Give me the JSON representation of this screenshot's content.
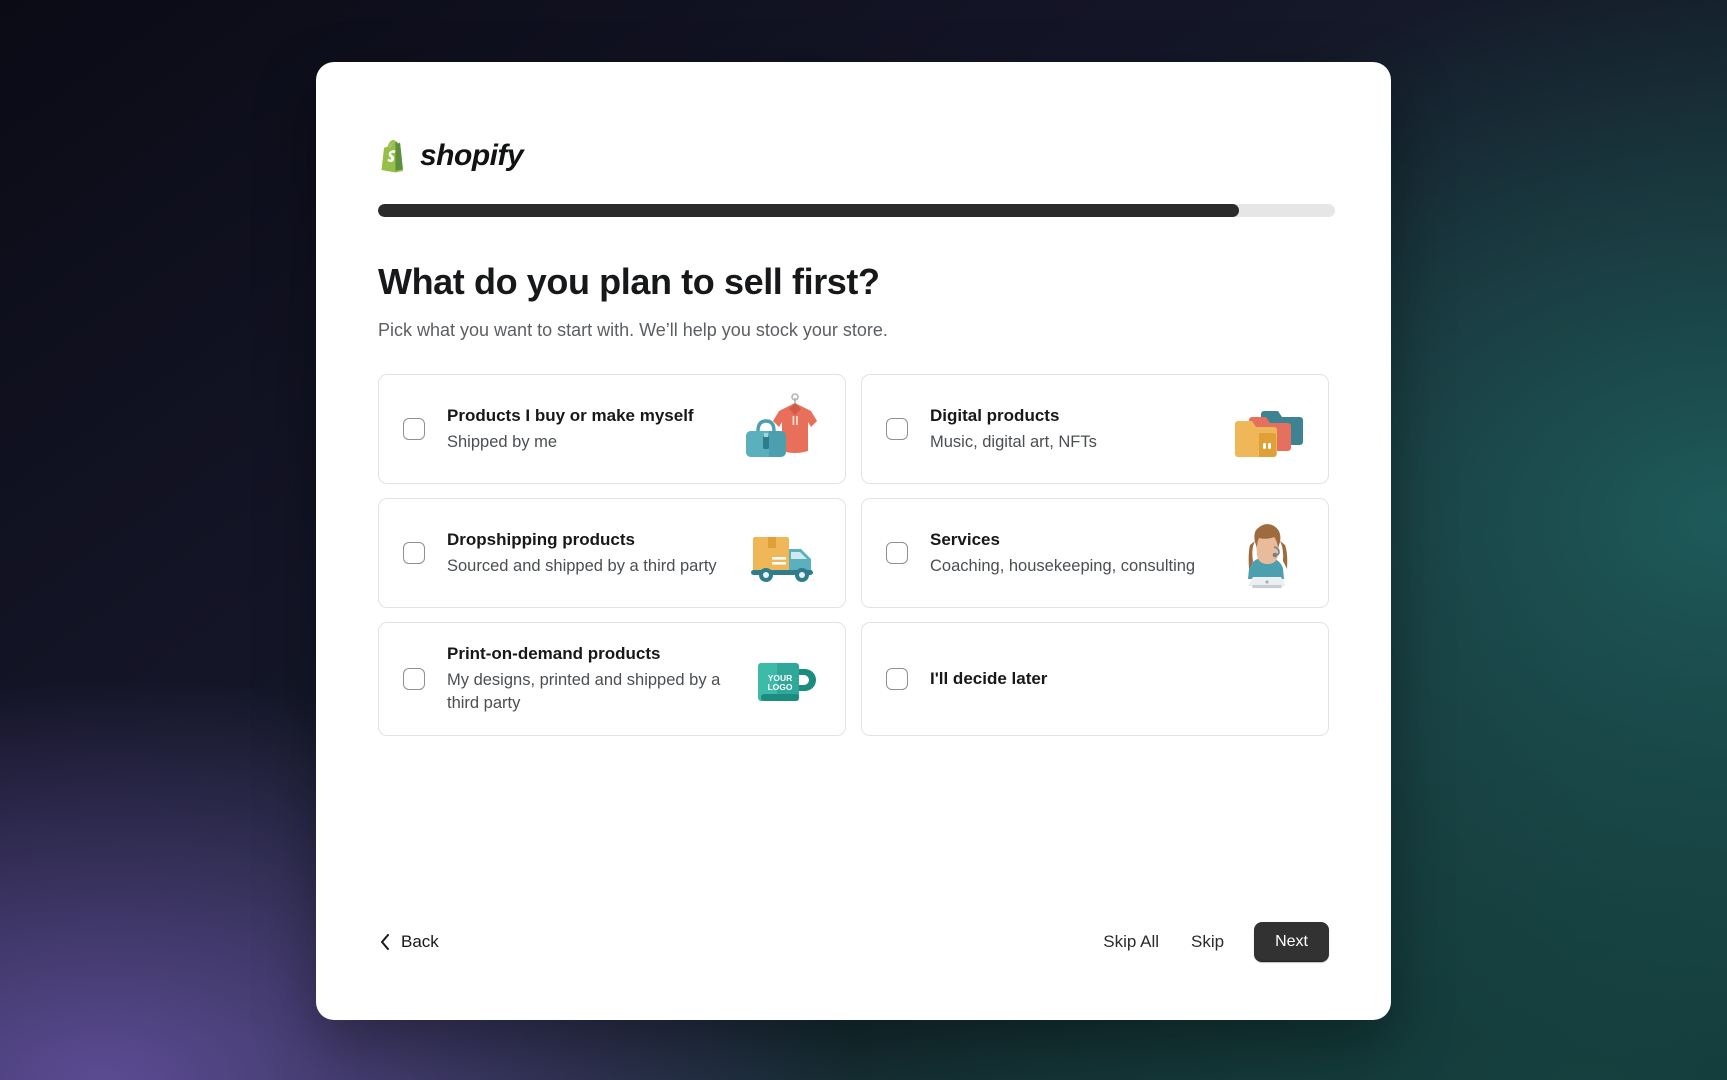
{
  "brand": {
    "name": "shopify",
    "logo_icon": "shopify-bag-icon",
    "green": "#95BF47",
    "dark_green": "#5E8E3E"
  },
  "progress": {
    "percent": 90,
    "fill_color": "#2b2b2b",
    "track_color": "#e6e6e6"
  },
  "page": {
    "title": "What do you plan to sell first?",
    "subtitle": "Pick what you want to start with. We’ll help you stock your store."
  },
  "options": [
    {
      "id": "products-i-buy-or-make-myself",
      "title": "Products I buy or make myself",
      "sub": "Shipped by me",
      "icon": "handbag-and-hoodie-icon",
      "checked": false
    },
    {
      "id": "digital-products",
      "title": "Digital products",
      "sub": "Music, digital art, NFTs",
      "icon": "folders-icon",
      "checked": false
    },
    {
      "id": "dropshipping-products",
      "title": "Dropshipping products",
      "sub": "Sourced and shipped by a third party",
      "icon": "delivery-truck-icon",
      "checked": false
    },
    {
      "id": "services",
      "title": "Services",
      "sub": "Coaching, housekeeping, consulting",
      "icon": "person-with-laptop-icon",
      "checked": false
    },
    {
      "id": "print-on-demand-products",
      "title": "Print-on-demand products",
      "sub": "My designs, printed and shipped by a third party",
      "icon": "branded-mug-icon",
      "mug_line1": "YOUR",
      "mug_line2": "LOGO",
      "checked": false
    },
    {
      "id": "ill-decide-later",
      "title": "I'll decide later",
      "sub": "",
      "icon": "none",
      "checked": false
    }
  ],
  "footer": {
    "back_label": "Back",
    "back_icon": "chevron-left-icon",
    "skip_all_label": "Skip All",
    "skip_label": "Skip",
    "next_label": "Next",
    "next_bg": "#323232"
  }
}
